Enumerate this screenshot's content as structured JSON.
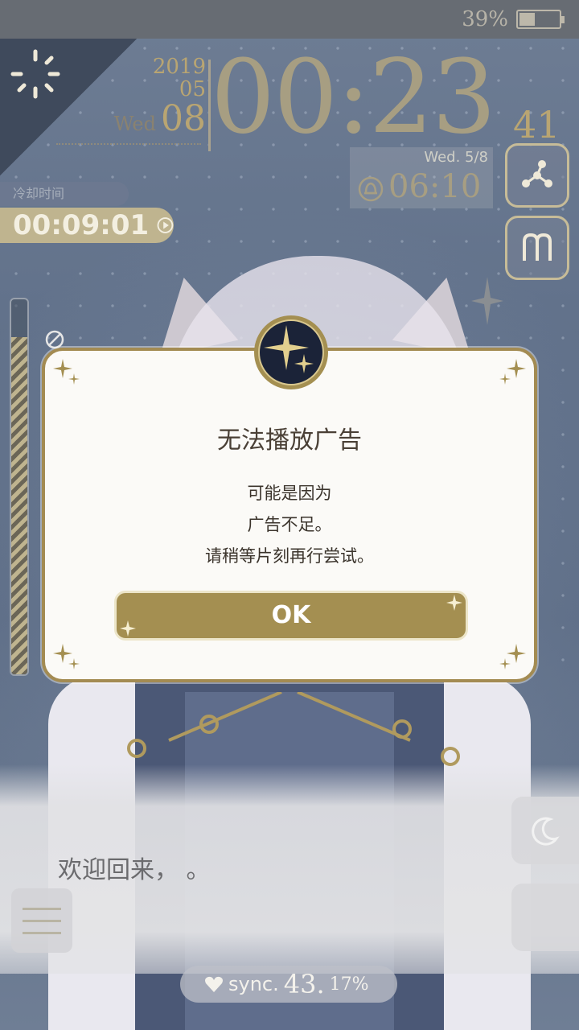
{
  "status_bar": {
    "battery_percent_label": "39%",
    "battery_level": 0.39
  },
  "clock": {
    "year": "2019",
    "month": "05",
    "day_of_week": "Wed",
    "day": "08",
    "time": "00:23",
    "seconds": "41"
  },
  "alarm": {
    "day": "Wed.  5/8",
    "time": "06:10",
    "icon": "bell-icon"
  },
  "cooldown": {
    "label": "冷却时间",
    "time": "00:09:01",
    "icon": "play-circle-icon"
  },
  "gauge": {
    "level": 0.9
  },
  "side_buttons": [
    {
      "icon": "share-icon"
    },
    {
      "icon": "m-logo-icon"
    },
    {
      "icon": "moon-icon"
    }
  ],
  "modal": {
    "title": "无法播放广告",
    "lines": [
      "可能是因为",
      "广告不足。",
      "请稍等片刻再行尝试。"
    ],
    "ok_label": "OK",
    "badge_icon": "star-emblem-icon"
  },
  "dialogue": {
    "text": "欢迎回来，  。"
  },
  "sync": {
    "label": "sync.",
    "value": "43.",
    "unit": "17%",
    "icon": "heart-icon"
  },
  "colors": {
    "gold": "#a48f51",
    "modal_bg": "#fbfaf7",
    "background": "#5d6c82"
  }
}
